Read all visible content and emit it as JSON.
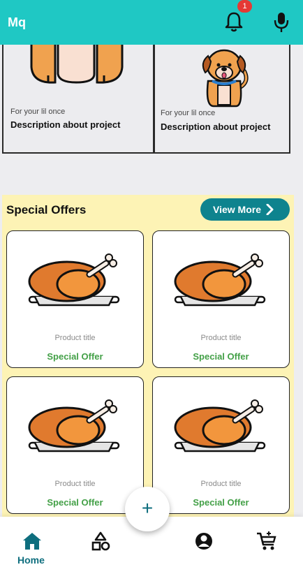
{
  "app": {
    "title": "Mq"
  },
  "header": {
    "notification_count": "1"
  },
  "project_cards": [
    {
      "subtitle": "For your lil once",
      "description": "Description about project",
      "icon": "dog-icon"
    },
    {
      "subtitle": "For your lil once",
      "description": "Description about project",
      "icon": "dog-icon"
    }
  ],
  "special_offers": {
    "title": "Special Offers",
    "view_more_label": "View More",
    "products": [
      {
        "title": "Product title",
        "offer": "Special Offer",
        "icon": "roast-chicken-icon"
      },
      {
        "title": "Product title",
        "offer": "Special Offer",
        "icon": "roast-chicken-icon"
      },
      {
        "title": "Product title",
        "offer": "Special Offer",
        "icon": "roast-chicken-icon"
      },
      {
        "title": "Product title",
        "offer": "Special Offer",
        "icon": "roast-chicken-icon"
      }
    ]
  },
  "bottom_nav": {
    "home_label": "Home",
    "items": [
      "home-icon",
      "categories-icon",
      "profile-icon",
      "cart-icon"
    ],
    "fab_symbol": "+"
  },
  "colors": {
    "appbar": "#1FC8C4",
    "accent": "#0E838E",
    "offer_text": "#43A047",
    "offers_bg": "#FDF3B5",
    "badge": "#E53935"
  }
}
